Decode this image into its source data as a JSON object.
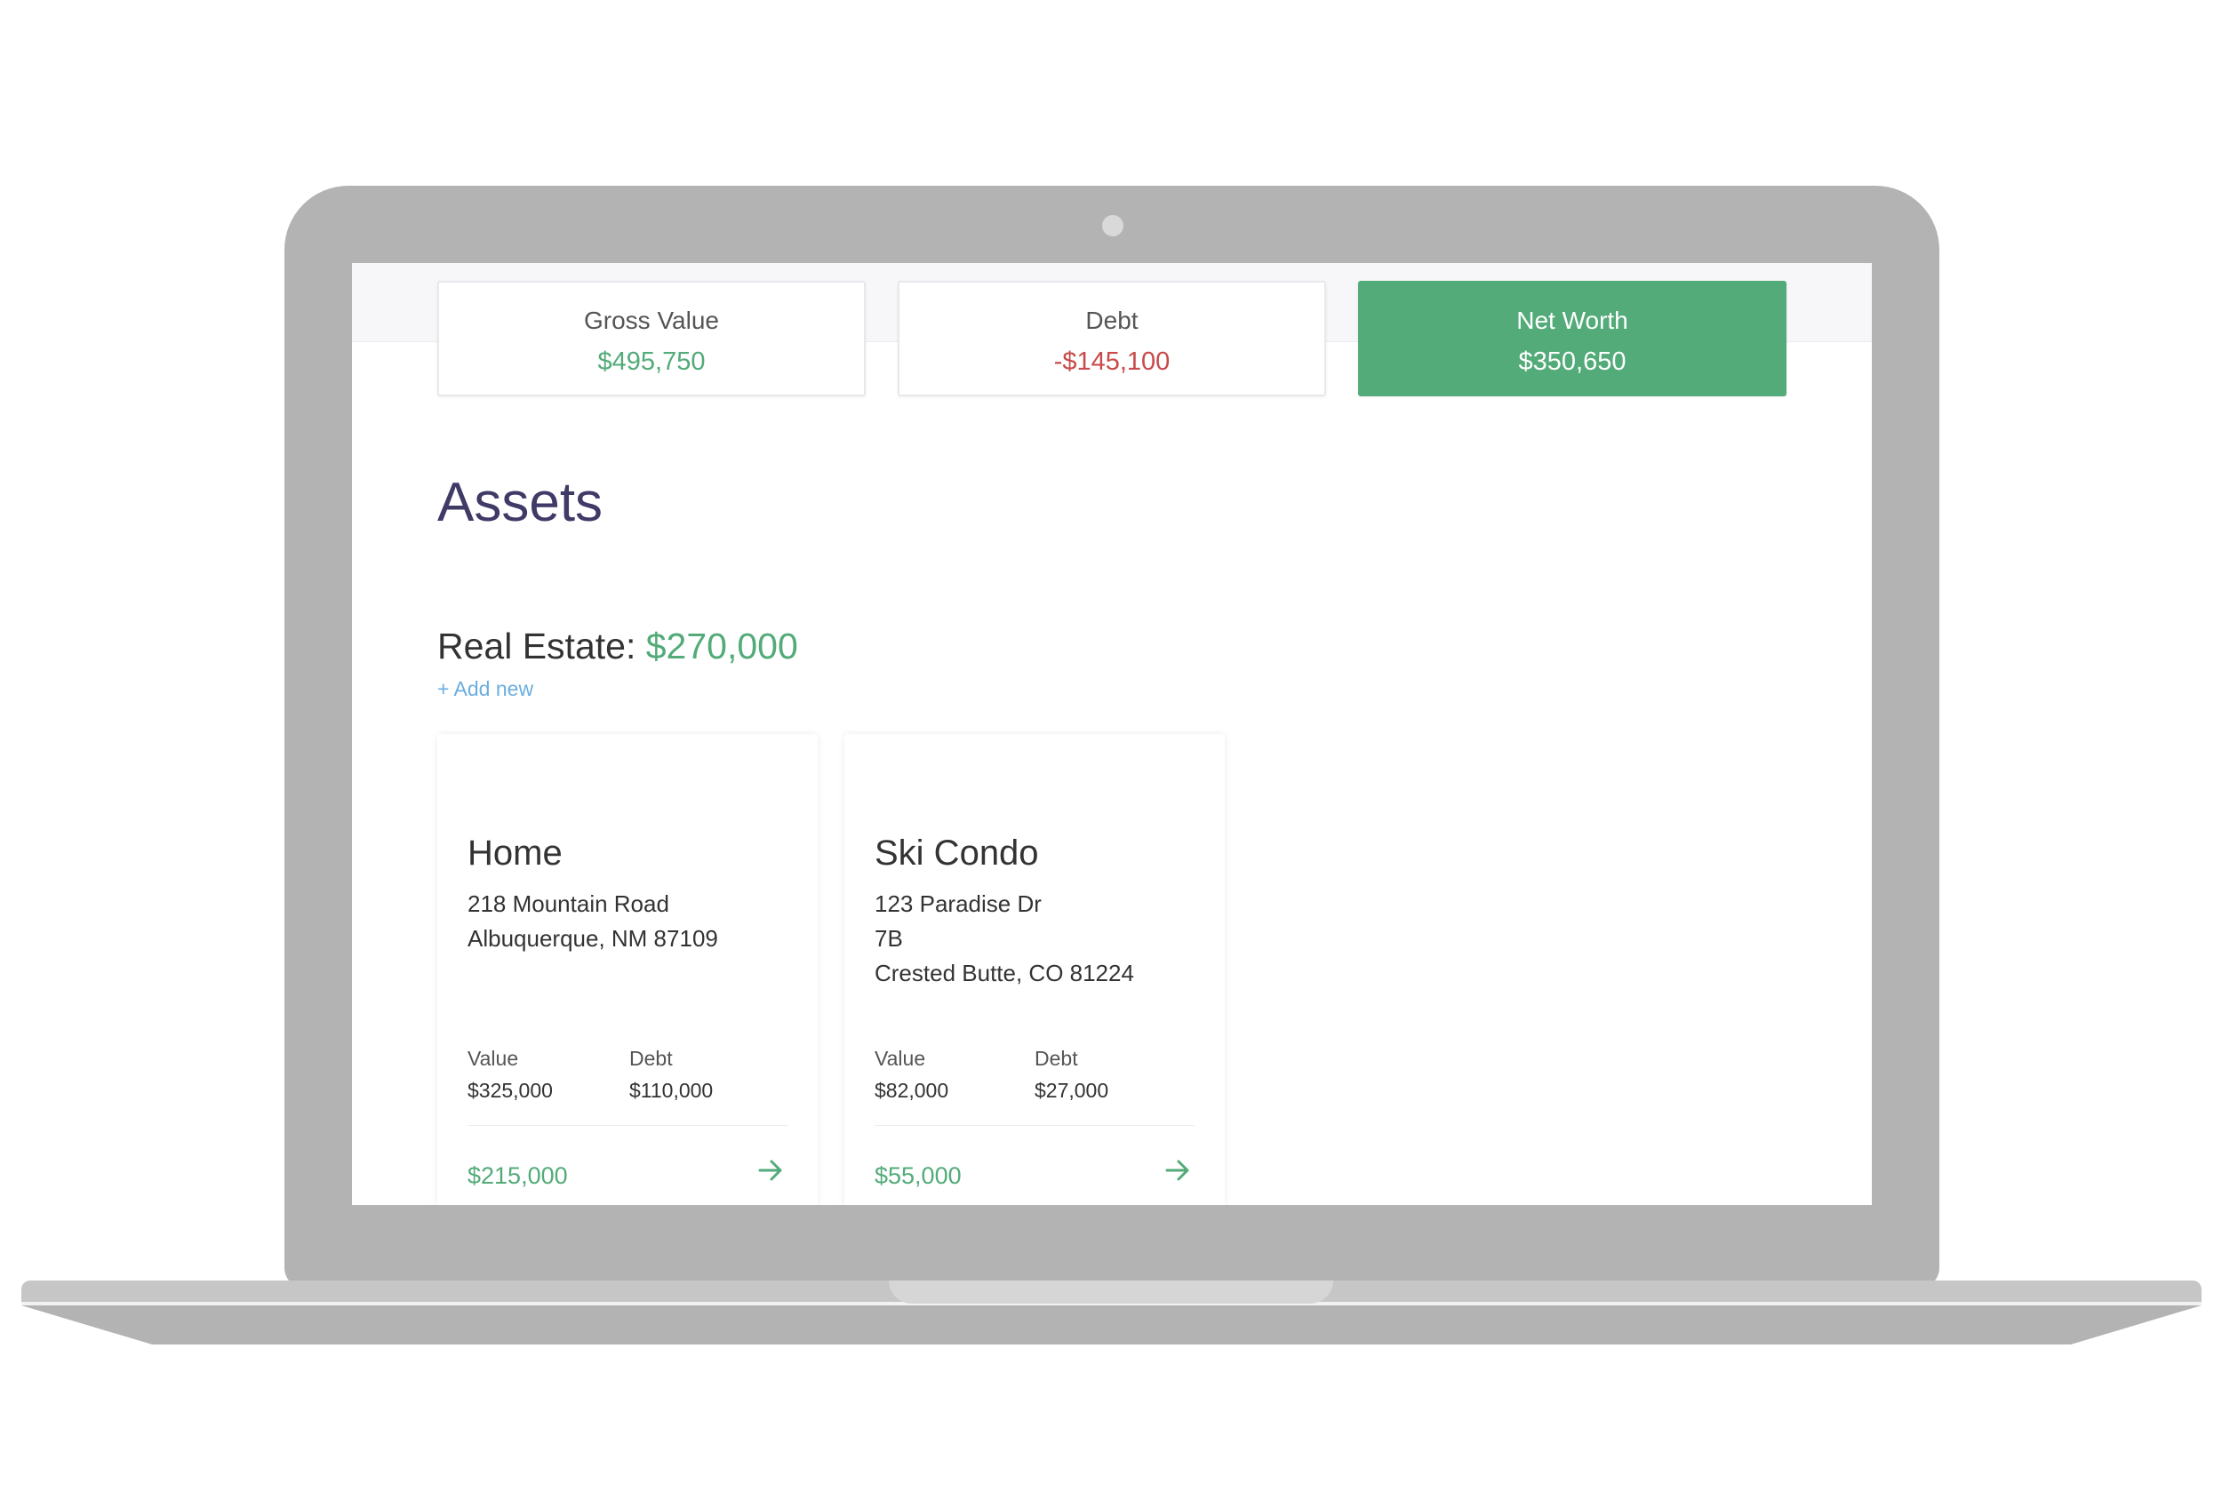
{
  "summary": {
    "gross": {
      "label": "Gross Value",
      "value": "$495,750"
    },
    "debt": {
      "label": "Debt",
      "value": "-$145,100"
    },
    "net": {
      "label": "Net Worth",
      "value": "$350,650"
    }
  },
  "assets": {
    "title": "Assets",
    "real_estate": {
      "label": "Real Estate:",
      "total": "$270,000",
      "add_new": "+ Add new",
      "items": [
        {
          "name": "Home",
          "address": [
            "218 Mountain Road",
            "Albuquerque, NM 87109"
          ],
          "value_label": "Value",
          "value": "$325,000",
          "debt_label": "Debt",
          "debt": "$110,000",
          "equity": "$215,000"
        },
        {
          "name": "Ski Condo",
          "address": [
            "123 Paradise Dr",
            "7B",
            "Crested Butte, CO 81224"
          ],
          "value_label": "Value",
          "value": "$82,000",
          "debt_label": "Debt",
          "debt": "$27,000",
          "equity": "$55,000"
        }
      ]
    }
  },
  "colors": {
    "accent_green": "#52ab78",
    "negative_red": "#c84a4a",
    "title_purple": "#3f3a66",
    "link_blue": "#6aaee0",
    "laptop_gray": "#b3b3b3"
  },
  "icons": {
    "card_link": "arrow-right-icon"
  }
}
